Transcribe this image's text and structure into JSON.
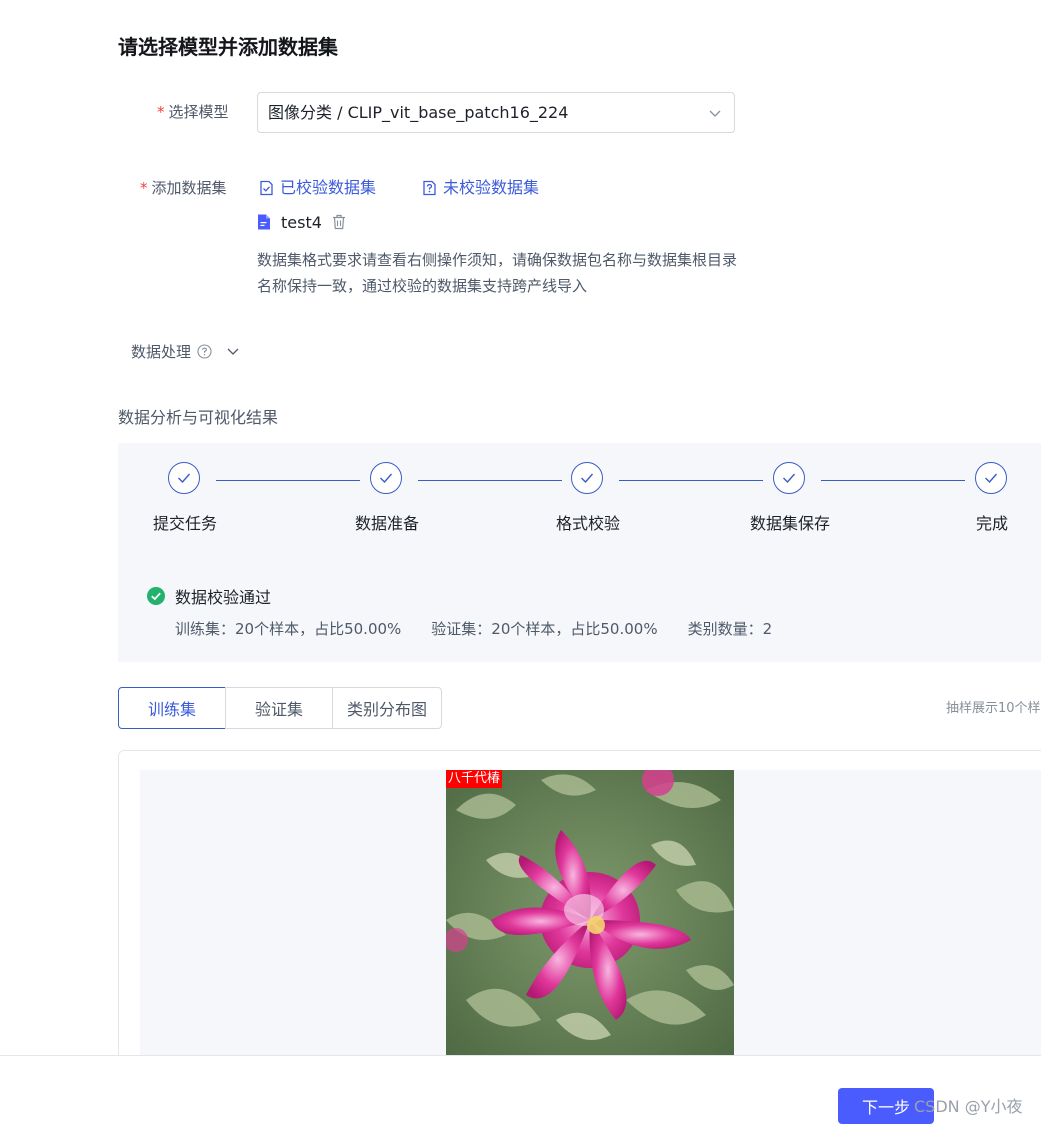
{
  "page": {
    "title": "请选择模型并添加数据集"
  },
  "form": {
    "model_label": "选择模型",
    "model_value": "图像分类 / CLIP_vit_base_patch16_224",
    "dataset_label": "添加数据集",
    "required_mark": "*",
    "verified_link": "已校验数据集",
    "unverified_link": "未校验数据集",
    "file_name": "test4",
    "hint": "数据集格式要求请查看右侧操作须知，请确保数据包名称与数据集根目录名称保持一致，通过校验的数据集支持跨产线导入",
    "processing_label": "数据处理"
  },
  "analysis": {
    "title": "数据分析与可视化结果",
    "steps": [
      "提交任务",
      "数据准备",
      "格式校验",
      "数据集保存",
      "完成"
    ],
    "status": "数据校验通过",
    "train_stat": "训练集：20个样本，占比50.00%",
    "val_stat": "验证集：20个样本，占比50.00%",
    "class_stat": "类别数量：2"
  },
  "tabs": [
    {
      "label": "训练集",
      "active": true
    },
    {
      "label": "验证集",
      "active": false
    },
    {
      "label": "类别分布图",
      "active": false
    }
  ],
  "sample_note": "抽样展示10个样",
  "sample": {
    "label": "八千代椿"
  },
  "footer": {
    "next_label": "下一步",
    "watermark": "CSDN @Y小夜"
  },
  "colors": {
    "primary": "#3b5bdb",
    "button": "#4b5cff",
    "success": "#23b26d",
    "required": "#f53f3f"
  }
}
